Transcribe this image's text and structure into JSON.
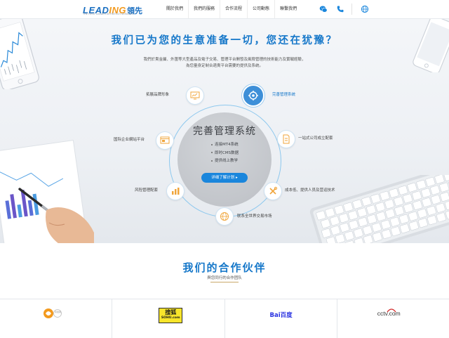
{
  "header": {
    "brand_word_a": "LEAD",
    "brand_word_b": "ING",
    "brand_cn": "領先",
    "brand_sub": "THE FIRST LEADER IN FINTECH SERVICES",
    "nav": [
      "關於我們",
      "我們的服務",
      "合作流程",
      "公司動態",
      "聯繫我們"
    ],
    "icons": [
      "wechat-icon",
      "phone-icon",
      "globe-icon"
    ]
  },
  "hero": {
    "title": "我们已为您的生意准备一切，您还在犹豫？",
    "description_lines": [
      "我們於貴金屬、外匯等大型產品及電子交易、管理平台開發及風險管理的技術能力及實戰經驗，",
      "為您量身定制合適貴平台需要的提供及系统。"
    ],
    "core": {
      "title": "完善管理系统",
      "items": [
        "连接MT4系统",
        "即时CMS数据",
        "提供线上教学"
      ],
      "button": "详细了解计划 ▸"
    },
    "nodes": [
      {
        "label": "拓展品牌形象",
        "icon": "monitor-chart-icon"
      },
      {
        "label": "完善管理系统",
        "icon": "management-gear-icon",
        "active": true
      },
      {
        "label": "国际企业網站平台",
        "icon": "website-icon"
      },
      {
        "label": "一站式公司成立配套",
        "icon": "document-icon"
      },
      {
        "label": "风险管理配套",
        "icon": "risk-chart-icon"
      },
      {
        "label": "成本低、提供人员及营运技术",
        "icon": "tools-icon"
      },
      {
        "label": "联系全世界交易市场",
        "icon": "globe-icon"
      }
    ]
  },
  "partners": {
    "title": "我们的合作伙伴",
    "subtitle": "與您同行的合作团队",
    "logos": [
      {
        "name": "phoenix-logo",
        "text": "凤凰网"
      },
      {
        "name": "sohu-logo",
        "text_cn": "搜狐",
        "text_en": "SOHU.com"
      },
      {
        "name": "baidu-logo",
        "text": "Bai百度"
      },
      {
        "name": "cctv-logo",
        "text": "cctv.com"
      }
    ]
  },
  "colors": {
    "accent": "#1577c9",
    "brand_orange": "#f39a1e",
    "button": "#1a86dc"
  }
}
